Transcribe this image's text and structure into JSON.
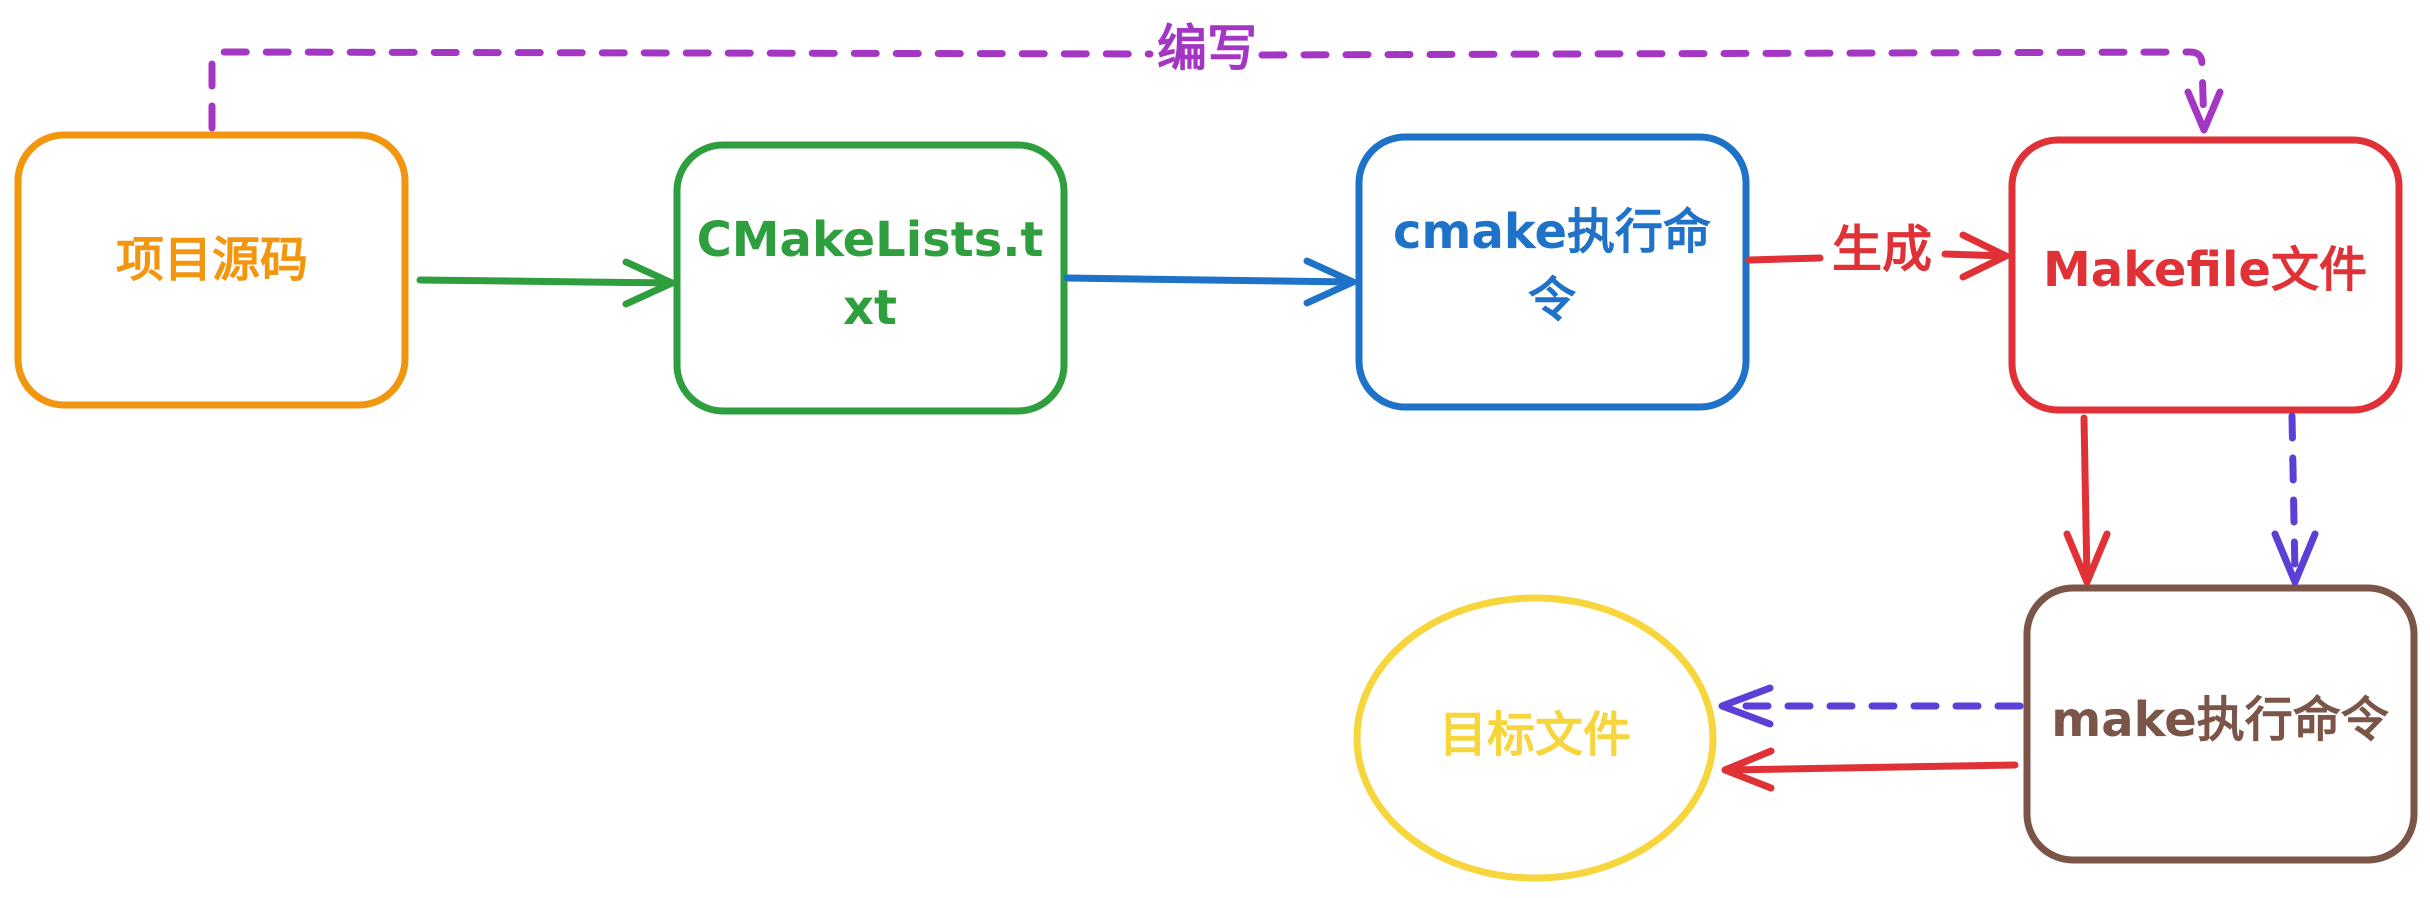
{
  "colors": {
    "orange": "#F2960F",
    "green": "#2E9E3E",
    "blue": "#1E73C8",
    "red": "#E03137",
    "purple": "#A436C4",
    "violet": "#5B3FD6",
    "brown": "#7A5548",
    "yellow": "#F7D53C"
  },
  "nodes": {
    "source": {
      "label": "项目源码",
      "color": "orange"
    },
    "cmakelists": {
      "label_line1": "CMakeLists.t",
      "label_line2": "xt",
      "color": "green"
    },
    "cmake_cmd": {
      "label_line1": "cmake执行命",
      "label_line2": "令",
      "color": "blue"
    },
    "makefile": {
      "label": "Makefile文件",
      "color": "red"
    },
    "make_cmd": {
      "label": "make执行命令",
      "color": "brown"
    },
    "target": {
      "label": "目标文件",
      "color": "yellow"
    }
  },
  "edges": {
    "write": {
      "label": "编写",
      "style": "dashed",
      "color": "purple"
    },
    "generate": {
      "label": "生成",
      "style": "solid",
      "color": "red"
    }
  }
}
